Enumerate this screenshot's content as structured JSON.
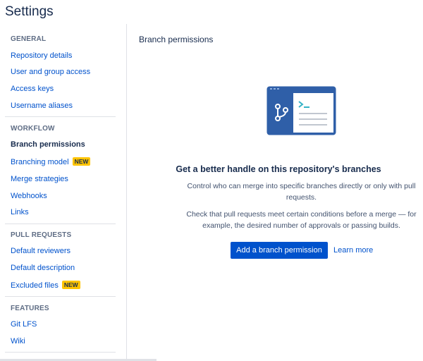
{
  "page": {
    "title": "Settings"
  },
  "sidebar": {
    "general": {
      "header": "GENERAL",
      "items": [
        {
          "label": "Repository details"
        },
        {
          "label": "User and group access"
        },
        {
          "label": "Access keys"
        },
        {
          "label": "Username aliases"
        }
      ]
    },
    "workflow": {
      "header": "WORKFLOW",
      "items": [
        {
          "label": "Branch permissions",
          "active": true
        },
        {
          "label": "Branching model",
          "badge": "NEW"
        },
        {
          "label": "Merge strategies"
        },
        {
          "label": "Webhooks"
        },
        {
          "label": "Links"
        }
      ]
    },
    "pull_requests": {
      "header": "PULL REQUESTS",
      "items": [
        {
          "label": "Default reviewers"
        },
        {
          "label": "Default description"
        },
        {
          "label": "Excluded files",
          "badge": "NEW"
        }
      ]
    },
    "features": {
      "header": "FEATURES",
      "items": [
        {
          "label": "Git LFS"
        },
        {
          "label": "Wiki"
        }
      ]
    }
  },
  "main": {
    "title": "Branch permissions",
    "illustration_icon": "branch-window-icon",
    "empty_state": {
      "heading": "Get a better handle on this repository's branches",
      "paragraph1": "Control who can merge into specific branches directly or only with pull requests.",
      "paragraph2": "Check that pull requests meet certain conditions before a merge — for example, the desired number of approvals or passing builds.",
      "primary_button": "Add a branch permission",
      "secondary_link": "Learn more"
    }
  },
  "colors": {
    "link": "#0052cc",
    "badge": "#ffc400",
    "primary": "#0052cc",
    "illustration_dark": "#2f5fa8",
    "illustration_accent": "#36b3c7"
  }
}
